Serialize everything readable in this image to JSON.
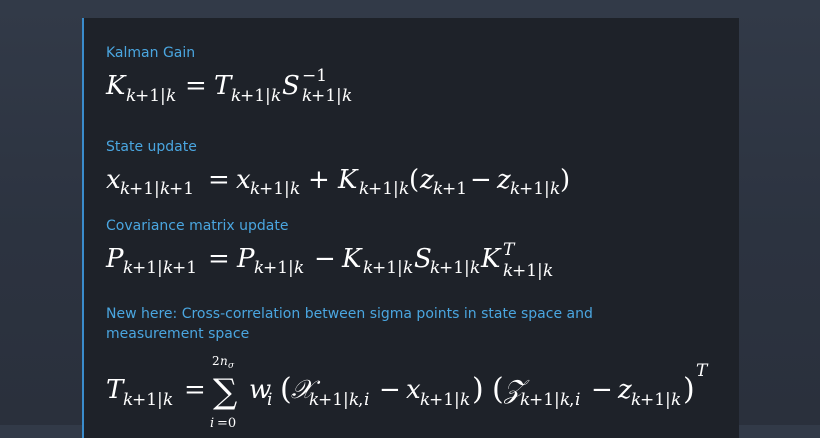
{
  "sections": [
    {
      "label": "Kalman Gain"
    },
    {
      "label": "State update"
    },
    {
      "label": "Covariance matrix update"
    },
    {
      "label": "New here: Cross-correlation between sigma points in state space and measurement space"
    }
  ],
  "equations": {
    "kalman_gain": "K_{k+1|k} = T_{k+1|k} S^{-1}_{k+1|k}",
    "state_update": "x_{k+1|k+1} = x_{k+1|k} + K_{k+1|k}(z_{k+1} - z_{k+1|k})",
    "covariance_update": "P_{k+1|k+1} = P_{k+1|k} - K_{k+1|k} S_{k+1|k} K^T_{k+1|k}",
    "cross_correlation": "T_{k+1|k} = sum_{i=0}^{2n_sigma} w_i (X_{k+1|k,i} - x_{k+1|k}) (Z_{k+1|k,i} - z_{k+1|k})^T"
  },
  "colors": {
    "label": "#4aa6e0",
    "card_border": "#3a8ccc",
    "card_background": "#1e2229",
    "page_background": "#2e3542"
  }
}
